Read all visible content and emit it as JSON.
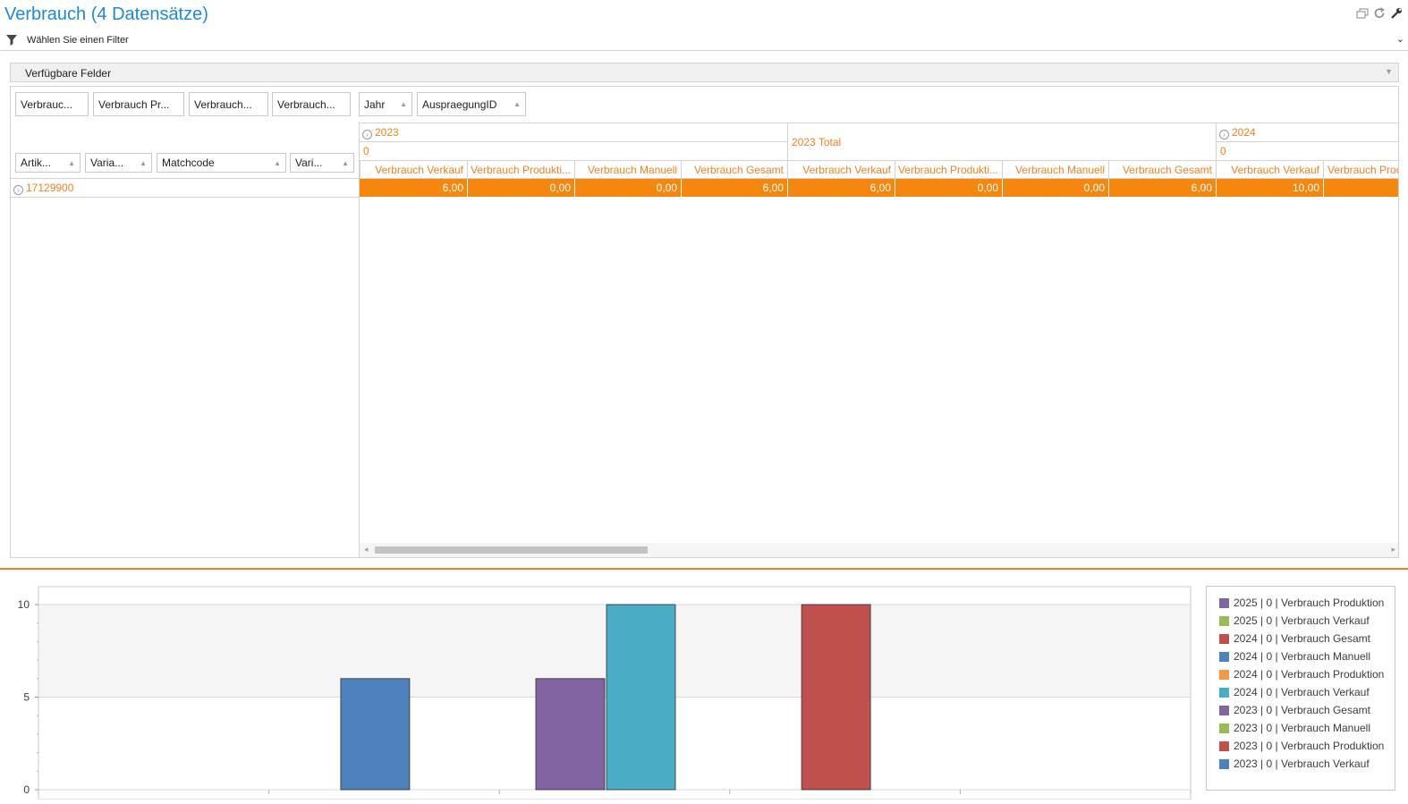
{
  "header": {
    "title": "Verbrauch (4 Datensätze)",
    "icons": [
      "restore-window-icon",
      "refresh-icon",
      "wrench-icon"
    ]
  },
  "filter": {
    "label": "Wählen Sie einen Filter"
  },
  "fields_bar": {
    "label": "Verfügbare Felder"
  },
  "pivot": {
    "data_fields": [
      "Verbrauc...",
      "Verbrauch Pr...",
      "Verbrauch...",
      "Verbrauch..."
    ],
    "column_fields": [
      "Jahr",
      "AuspraegungID"
    ],
    "row_fields": [
      "Artik...",
      "Varia...",
      "Matchcode",
      "Vari..."
    ],
    "years": {
      "y2023": "2023",
      "y2023_sub": "0",
      "y2023_total": "2023 Total",
      "y2024": "2024",
      "y2024_sub": "0"
    },
    "column_headers": [
      "Verbrauch Verkauf",
      "Verbrauch Produkti...",
      "Verbrauch Manuell",
      "Verbrauch Gesamt",
      "Verbrauch Verkauf",
      "Verbrauch Produkti...",
      "Verbrauch Manuell",
      "Verbrauch Gesamt",
      "Verbrauch Verkauf",
      "Verbrauch Prod"
    ],
    "rows": [
      {
        "label": "17129900",
        "values": [
          "6,00",
          "0,00",
          "0,00",
          "6,00",
          "6,00",
          "0,00",
          "0,00",
          "6,00",
          "10,00",
          ""
        ]
      }
    ]
  },
  "chart_data": {
    "type": "bar",
    "y_ticks": [
      "10",
      "5",
      "0"
    ],
    "ylim": [
      0,
      10
    ],
    "bars": [
      {
        "group": 0,
        "value": 0
      },
      {
        "group": 1,
        "value": 6,
        "color": "#4f81bd",
        "series": "2023 | 0 | Verbrauch Verkauf"
      },
      {
        "group": 2,
        "value": 6,
        "color": "#8064a2",
        "series": "2023 | 0 | Verbrauch Gesamt"
      },
      {
        "group": 2,
        "value": 10,
        "color": "#4bacc6",
        "series": "2024 | 0 | Verbrauch Verkauf"
      },
      {
        "group": 3,
        "value": 10,
        "color": "#c0504d",
        "series": "2024 | 0 | Verbrauch Gesamt"
      },
      {
        "group": 4,
        "value": 0
      }
    ],
    "legend": [
      {
        "name": "2025 | 0 | Verbrauch Produktion",
        "color": "#8064a2"
      },
      {
        "name": "2025 | 0 | Verbrauch Verkauf",
        "color": "#9bbb59"
      },
      {
        "name": "2024 | 0 | Verbrauch Gesamt",
        "color": "#c0504d"
      },
      {
        "name": "2024 | 0 | Verbrauch Manuell",
        "color": "#4f81bd"
      },
      {
        "name": "2024 | 0 | Verbrauch Produktion",
        "color": "#f79646"
      },
      {
        "name": "2024 | 0 | Verbrauch Verkauf",
        "color": "#4bacc6"
      },
      {
        "name": "2023 | 0 | Verbrauch Gesamt",
        "color": "#8064a2"
      },
      {
        "name": "2023 | 0 | Verbrauch Manuell",
        "color": "#9bbb59"
      },
      {
        "name": "2023 | 0 | Verbrauch Produktion",
        "color": "#c0504d"
      },
      {
        "name": "2023 | 0 | Verbrauch Verkauf",
        "color": "#4f81bd"
      }
    ],
    "legend_position": "right"
  }
}
